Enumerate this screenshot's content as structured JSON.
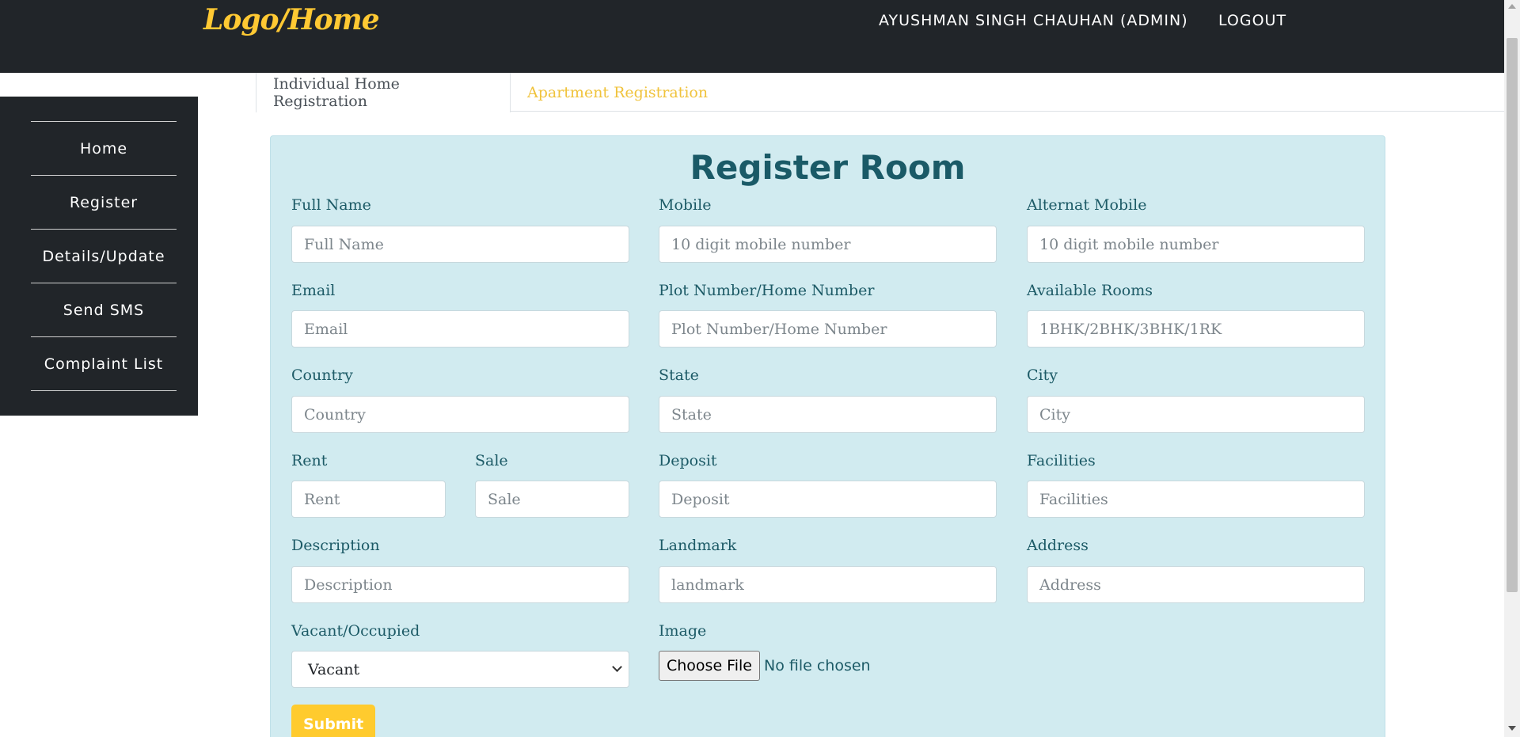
{
  "navbar": {
    "logo": "Logo/Home",
    "user": "AYUSHMAN SINGH CHAUHAN (ADMIN)",
    "logout": "LOGOUT"
  },
  "sidebar": {
    "items": [
      {
        "label": "Home"
      },
      {
        "label": "Register"
      },
      {
        "label": "Details/Update"
      },
      {
        "label": "Send SMS"
      },
      {
        "label": "Complaint List"
      }
    ]
  },
  "tabs": [
    {
      "label": "Individual Home Registration",
      "active": true
    },
    {
      "label": "Apartment Registration",
      "active": false
    }
  ],
  "form": {
    "title": "Register Room",
    "fields": {
      "full_name": {
        "label": "Full Name",
        "placeholder": "Full Name",
        "value": ""
      },
      "mobile": {
        "label": "Mobile",
        "placeholder": "10 digit mobile number",
        "value": ""
      },
      "alt_mobile": {
        "label": "Alternat Mobile",
        "placeholder": "10 digit mobile number",
        "value": ""
      },
      "email": {
        "label": "Email",
        "placeholder": "Email",
        "value": ""
      },
      "plot_number": {
        "label": "Plot Number/Home Number",
        "placeholder": "Plot Number/Home Number",
        "value": ""
      },
      "available_rooms": {
        "label": "Available Rooms",
        "placeholder": "1BHK/2BHK/3BHK/1RK",
        "value": ""
      },
      "country": {
        "label": "Country",
        "placeholder": "Country",
        "value": ""
      },
      "state": {
        "label": "State",
        "placeholder": "State",
        "value": ""
      },
      "city": {
        "label": "City",
        "placeholder": "City",
        "value": ""
      },
      "rent": {
        "label": "Rent",
        "placeholder": "Rent",
        "value": ""
      },
      "sale": {
        "label": "Sale",
        "placeholder": "Sale",
        "value": ""
      },
      "deposit": {
        "label": "Deposit",
        "placeholder": "Deposit",
        "value": ""
      },
      "facilities": {
        "label": "Facilities",
        "placeholder": "Facilities",
        "value": ""
      },
      "description": {
        "label": "Description",
        "placeholder": "Description",
        "value": ""
      },
      "landmark": {
        "label": "Landmark",
        "placeholder": "landmark",
        "value": ""
      },
      "address": {
        "label": "Address",
        "placeholder": "Address",
        "value": ""
      },
      "vacancy": {
        "label": "Vacant/Occupied",
        "selected": "Vacant"
      },
      "image": {
        "label": "Image",
        "button": "Choose File",
        "status": "No file chosen"
      }
    },
    "submit_label": "Submit"
  },
  "icons": {
    "select_arrow": "chevron-down-icon",
    "scroll_up": "arrow-up-icon",
    "scroll_down": "arrow-down-icon"
  },
  "colors": {
    "navbar_bg": "#212529",
    "logo": "#ffc933",
    "card_bg": "#d1ebf0",
    "label": "#1c5a66",
    "title": "#1a5a67",
    "submit_bg": "#ffcb2e",
    "inactive_tab": "#f0c33c"
  }
}
